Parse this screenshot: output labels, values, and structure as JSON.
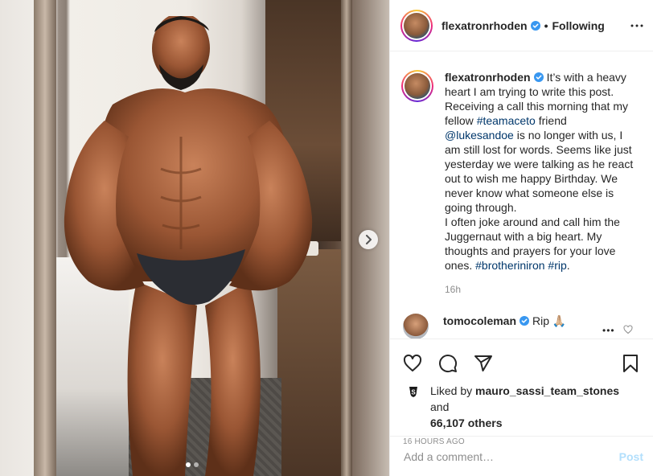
{
  "post": {
    "author": "flexatronrhoden",
    "follow_status": "Following",
    "separator": "•",
    "caption_parts": {
      "p1": "It’s with a heavy heart I am trying to write this post. Receiving a call this morning that my fellow ",
      "tag1": "#teamaceto",
      "p2": " friend ",
      "mention": "@lukesandoe",
      "p3": " is no longer with us, I am still lost for words. Seems like just yesterday we were talking as he react out to wish me happy Birthday. We never know what someone else is going through.",
      "p4": "I often joke around and call him the Juggernaut with a big heart. My thoughts and prayers for your love ones. ",
      "tag2": "#brotheriniron",
      "tag3": "#rip",
      "p5": "."
    },
    "caption_time": "16h",
    "comment": {
      "user": "tomocoleman",
      "text": "Rip 🙏🏼"
    },
    "likes": {
      "prefix": "Liked by ",
      "user": "mauro_sassi_team_stones",
      "middle": " and",
      "count": "66,107 others"
    },
    "date": "16 HOURS AGO",
    "comment_input": {
      "placeholder": "Add a comment…",
      "post_label": "Post"
    }
  },
  "carousel": {
    "total": 2,
    "current": 1
  },
  "colors": {
    "link": "#00376b",
    "verified": "#3897f0",
    "post_button_disabled": "#b2dffc",
    "muted": "#8e8e8e"
  },
  "icons": [
    "more-icon",
    "verified-icon",
    "heart-icon",
    "comment-icon",
    "share-icon",
    "bookmark-icon",
    "next-arrow-icon"
  ]
}
